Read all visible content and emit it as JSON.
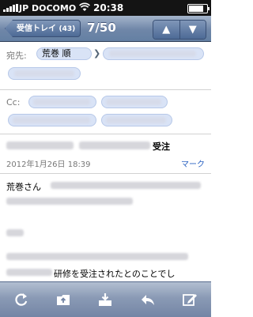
{
  "status_bar": {
    "carrier": "JP DOCOMO",
    "time": "20:38",
    "battery_level": 0.9
  },
  "nav": {
    "back_label": "受信トレイ",
    "back_count": "(43)",
    "title": "7/50",
    "up_icon": "up-arrow-icon",
    "down_icon": "down-arrow-icon"
  },
  "header": {
    "to_label": "宛先:",
    "to_first_recipient": "荒巻 順",
    "cc_label": "Cc:"
  },
  "message": {
    "subject_visible": "受注",
    "date": "2012年1月26日 18:39",
    "mark_label": "マーク",
    "greeting": "荒巻さん",
    "visible_fragment": "研修を受注されたとのことでし"
  },
  "toolbar": {
    "icons": [
      "refresh-icon",
      "move-folder-icon",
      "archive-icon",
      "reply-icon",
      "compose-icon"
    ]
  }
}
